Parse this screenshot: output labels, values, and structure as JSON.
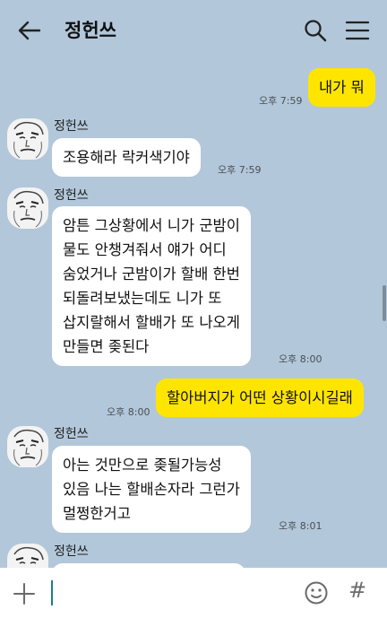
{
  "header": {
    "title": "정헌쓰",
    "back_icon": "arrow-left-icon",
    "search_icon": "search-icon",
    "menu_icon": "hamburger-menu-icon"
  },
  "messages": [
    {
      "from": "me",
      "lines": [
        "내가 뭐"
      ],
      "time": "오후 7:59"
    },
    {
      "from": "them",
      "sender": "정헌쓰",
      "lines": [
        "조용해라 락커색기야"
      ],
      "time": "오후 7:59"
    },
    {
      "from": "them",
      "sender": "정헌쓰",
      "lines": [
        "암튼 그상황에서 니가 군밤이",
        "물도 안챙겨줘서 얘가 어디",
        "숨었거나 군밤이가 할배 한번",
        "되돌려보냈는데도 니가 또",
        "삽지랄해서 할배가 또 나오게",
        "만들면 좆된다"
      ],
      "time": "오후 8:00"
    },
    {
      "from": "me",
      "lines": [
        "할아버지가 어떤 상황이시길래"
      ],
      "time": "오후 8:00"
    },
    {
      "from": "them",
      "sender": "정헌쓰",
      "lines": [
        "아는 것만으로 좆될가능성",
        "있음 나는 할배손자라 그런가",
        "멀쩡한거고"
      ],
      "time": "오후 8:01"
    },
    {
      "from": "them",
      "sender": "정헌쓰",
      "lines": [],
      "time": ""
    }
  ],
  "input": {
    "plus_icon": "plus-icon",
    "emoji_icon": "emoji-icon",
    "hash_label": "#"
  },
  "colors": {
    "background": "#b2c7da",
    "my_bubble": "#fee500",
    "their_bubble": "#ffffff"
  }
}
